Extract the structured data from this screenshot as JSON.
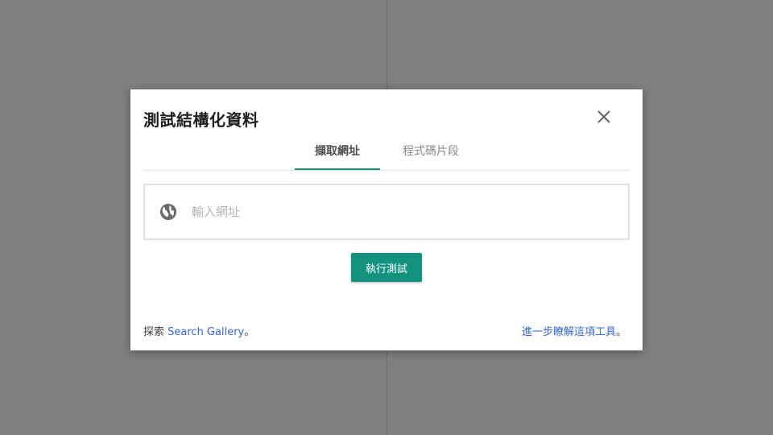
{
  "dialog": {
    "title": "測試結構化資料",
    "close_icon": "close-icon",
    "tabs": [
      {
        "label": "擷取網址",
        "active": true
      },
      {
        "label": "程式碼片段",
        "active": false
      }
    ],
    "url_input": {
      "icon": "globe-icon",
      "placeholder": "輸入網址",
      "value": ""
    },
    "run_button_label": "執行測試",
    "footer": {
      "explore_prefix": "探索 ",
      "explore_link": "Search Gallery",
      "explore_suffix": "。",
      "learn_link": "進一步瞭解這項工具",
      "learn_suffix": "。"
    }
  },
  "colors": {
    "backdrop": "#7f7f7f",
    "accent": "#13937f",
    "link": "#3367d6",
    "tab_indicator": "#1e8e7e"
  }
}
